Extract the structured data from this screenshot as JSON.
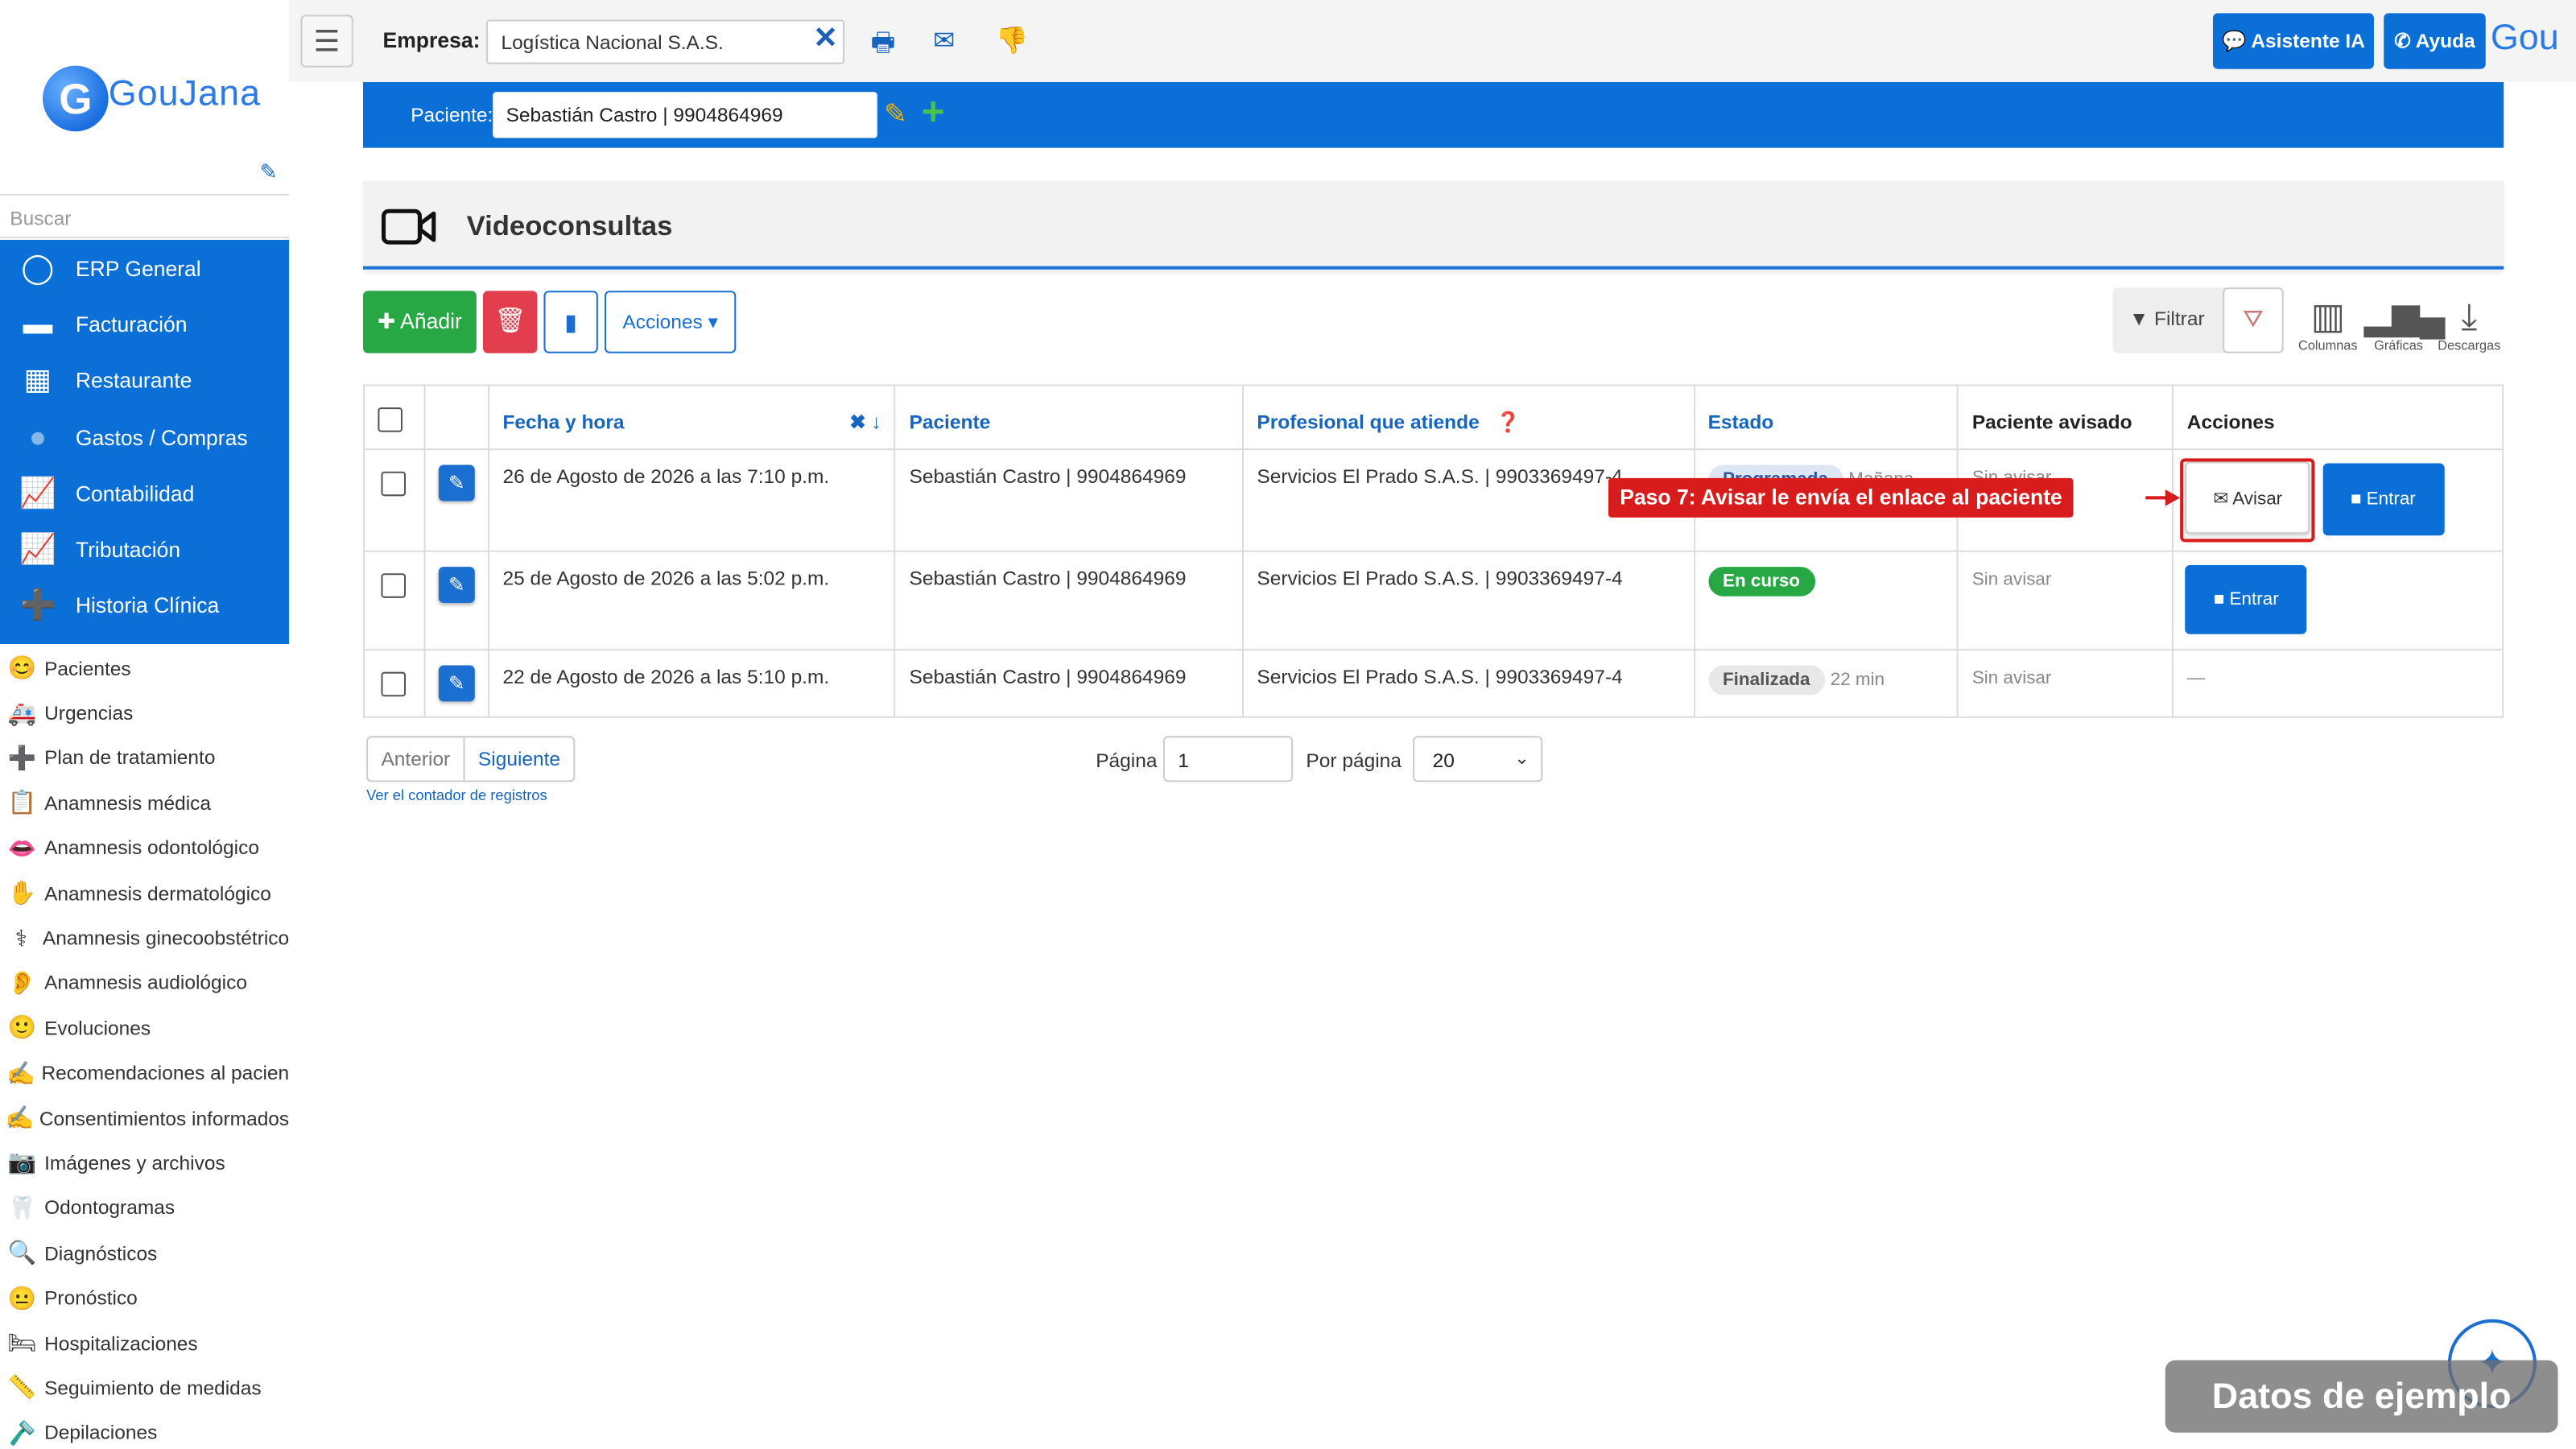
{
  "sidebar": {
    "logo_text": "GouJana",
    "logo_letter": "G",
    "search_placeholder": "Buscar",
    "modules": [
      {
        "label": "ERP General",
        "icon": "circle-icon"
      },
      {
        "label": "Facturación",
        "icon": "card-icon"
      },
      {
        "label": "Restaurante",
        "icon": "calendar-icon"
      },
      {
        "label": "Gastos / Compras",
        "icon": "blob-icon"
      },
      {
        "label": "Contabilidad",
        "icon": "chart-icon"
      },
      {
        "label": "Tributación",
        "icon": "chart-icon"
      },
      {
        "label": "Historia Clínica",
        "icon": "plus-icon"
      }
    ],
    "items": [
      {
        "label": "Pacientes",
        "icon": "😊"
      },
      {
        "label": "Urgencias",
        "icon": "🚑"
      },
      {
        "label": "Plan de tratamiento",
        "icon": "➕"
      },
      {
        "label": "Anamnesis médica",
        "icon": "📋"
      },
      {
        "label": "Anamnesis odontológico",
        "icon": "👄"
      },
      {
        "label": "Anamnesis dermatológico",
        "icon": "✋"
      },
      {
        "label": "Anamnesis ginecoobstétrico",
        "icon": "⚕"
      },
      {
        "label": "Anamnesis audiológico",
        "icon": "👂"
      },
      {
        "label": "Evoluciones",
        "icon": "🙂"
      },
      {
        "label": "Recomendaciones al pacien",
        "icon": "✍"
      },
      {
        "label": "Consentimientos informados",
        "icon": "✍"
      },
      {
        "label": "Imágenes y archivos",
        "icon": "📷"
      },
      {
        "label": "Odontogramas",
        "icon": "🦷"
      },
      {
        "label": "Diagnósticos",
        "icon": "🔍"
      },
      {
        "label": "Pronóstico",
        "icon": "😐"
      },
      {
        "label": "Hospitalizaciones",
        "icon": "🛏"
      },
      {
        "label": "Seguimiento de medidas",
        "icon": "📏"
      },
      {
        "label": "Depilaciones",
        "icon": "🪒"
      }
    ]
  },
  "topbar": {
    "menu_glyph": "☰",
    "empresa_label": "Empresa:",
    "empresa_value": "Logística Nacional S.A.S.",
    "assistant_label": "Asistente IA",
    "help_label": "Ayuda",
    "gou_text": "Gou"
  },
  "patient": {
    "label": "Paciente:",
    "value": "Sebastián Castro | 9904864969"
  },
  "page": {
    "title": "Videoconsultas"
  },
  "toolbar": {
    "add_label": "Añadir",
    "actions_label": "Acciones",
    "filter_label": "Filtrar",
    "columns_label": "Columnas",
    "charts_label": "Gráficas",
    "downloads_label": "Descargas"
  },
  "table": {
    "headers": {
      "date": "Fecha y hora",
      "patient": "Paciente",
      "professional": "Profesional que atiende",
      "status": "Estado",
      "notified": "Paciente avisado",
      "actions": "Acciones"
    },
    "rows": [
      {
        "date": "26 de Agosto de 2026 a las 7:10 p.m.",
        "patient": "Sebastián Castro | 9904864969",
        "professional": "Servicios El Prado S.A.S. | 9903369497-4",
        "status": "Programada",
        "status_extra": "Mañana",
        "notified": "Sin avisar",
        "notify_label": "Avisar",
        "enter_label": "Entrar"
      },
      {
        "date": "25 de Agosto de 2026 a las 5:02 p.m.",
        "patient": "Sebastián Castro | 9904864969",
        "professional": "Servicios El Prado S.A.S. | 9903369497-4",
        "status": "En curso",
        "status_extra": "",
        "notified": "Sin avisar",
        "enter_label": "Entrar"
      },
      {
        "date": "22 de Agosto de 2026 a las 5:10 p.m.",
        "patient": "Sebastián Castro | 9904864969",
        "professional": "Servicios El Prado S.A.S. | 9903369497-4",
        "status": "Finalizada",
        "status_extra": "22 min",
        "notified": "Sin avisar",
        "actions_text": "—"
      }
    ]
  },
  "callout": {
    "text": "Paso 7: Avisar le envía el enlace al paciente"
  },
  "pagination": {
    "prev_label": "Anterior",
    "next_label": "Siguiente",
    "counter_link": "Ver el contador de registros",
    "page_label": "Página",
    "page_value": "1",
    "per_page_label": "Por página",
    "per_page_value": "20"
  },
  "watermark": {
    "text": "Datos de ejemplo"
  },
  "colors": {
    "primary": "#0a6fd6",
    "success": "#28a745",
    "danger": "#e33e4e",
    "callout": "#d81b1b"
  }
}
